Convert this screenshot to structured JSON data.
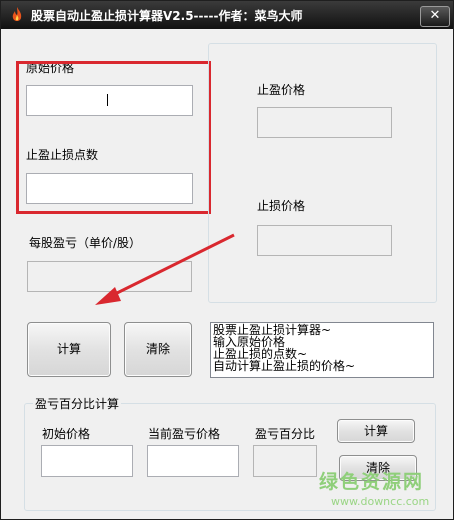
{
  "window": {
    "title": "股票自动止盈止损计算器V2.5-----作者：菜鸟大师",
    "close_label": "✕"
  },
  "fields": {
    "original_price_label": "原始价格",
    "points_label": "止盈止损点数",
    "per_share_label": "每股盈亏（单价/股）",
    "take_profit_label": "止盈价格",
    "stop_loss_label": "止损价格"
  },
  "buttons": {
    "calculate": "计算",
    "clear": "清除"
  },
  "memo": {
    "lines": [
      "股票止盈止损计算器~",
      "输入原始价格",
      "止盈止损的点数~",
      "自动计算止盈止损的价格~"
    ]
  },
  "percent_group": {
    "title": "盈亏百分比计算",
    "initial_price_label": "初始价格",
    "current_pl_label": "当前盈亏价格",
    "pl_percent_label": "盈亏百分比",
    "calculate": "计算",
    "clear": "清除"
  },
  "watermark": {
    "main": "绿色资源网",
    "sub": "www.downcc.com"
  },
  "annotation": {
    "highlight_color": "#d9282f"
  }
}
